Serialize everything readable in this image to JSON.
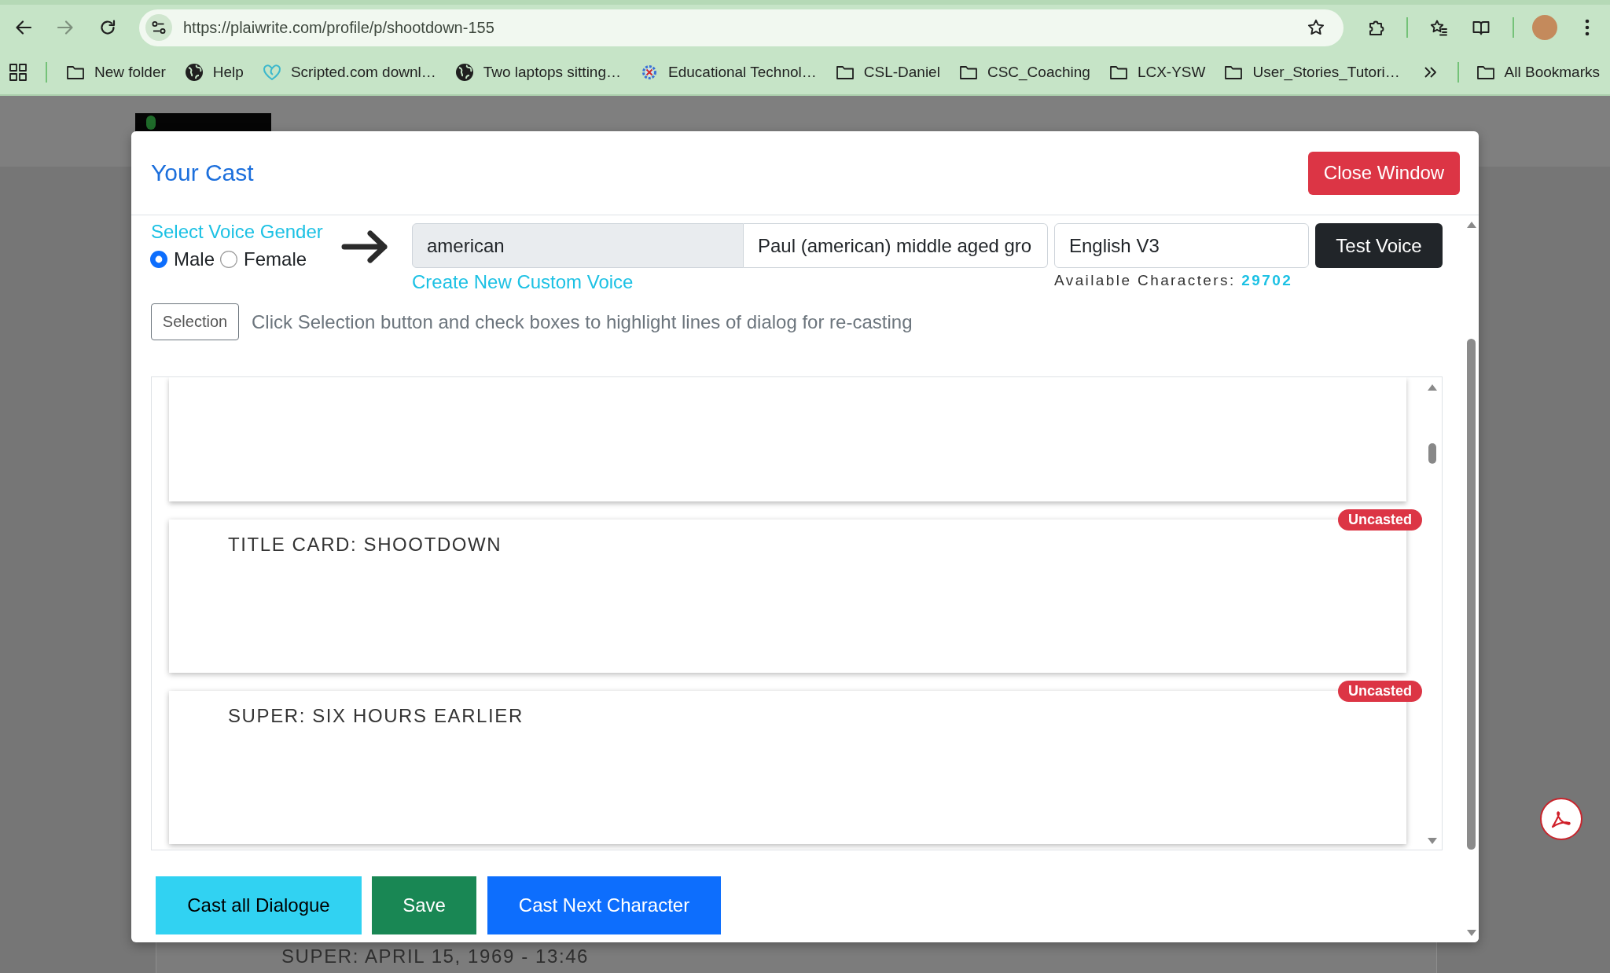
{
  "browser": {
    "forward_disabled": true,
    "url": "https://plaiwrite.com/profile/p/shootdown-155",
    "bookmarks": [
      {
        "label": "New folder",
        "kind": "folder"
      },
      {
        "label": "Help",
        "kind": "globe"
      },
      {
        "label": "Scripted.com downl…",
        "kind": "heart"
      },
      {
        "label": "Two laptops sitting…",
        "kind": "globe"
      },
      {
        "label": "Educational Technol…",
        "kind": "gear"
      },
      {
        "label": "CSL-Daniel",
        "kind": "folder"
      },
      {
        "label": "CSC_Coaching",
        "kind": "folder"
      },
      {
        "label": "LCX-YSW",
        "kind": "folder"
      },
      {
        "label": "User_Stories_Tutori…",
        "kind": "folder"
      }
    ],
    "all_bookmarks": "All Bookmarks"
  },
  "site": {
    "background_line": "SUPER: APRIL 15, 1969 - 13:46"
  },
  "modal": {
    "title": "Your Cast",
    "close_button": "Close Window",
    "gender_label": "Select Voice Gender",
    "gender_options": [
      {
        "label": "Male",
        "selected": true
      },
      {
        "label": "Female",
        "selected": false
      }
    ],
    "accent": "american",
    "voice": "Paul (american) middle aged gro",
    "model": "English V3",
    "test_button": "Test Voice",
    "custom_voice_link": "Create New Custom Voice",
    "characters": "Available Characters: **29702**",
    "selection_button": "Selection",
    "instruction": "Click Selection button and check boxes to highlight lines of dialog for re-casting",
    "cut_off_card": true,
    "lines": [
      {
        "text": "TITLE CARD: SHOOTDOWN",
        "badge": "Uncasted"
      },
      {
        "text": "SUPER: SIX HOURS EARLIER",
        "badge": "Uncasted"
      }
    ],
    "footer_buttons": [
      {
        "label": "Cast all Dialogue",
        "kind": "info"
      },
      {
        "label": "Save",
        "kind": "success"
      },
      {
        "label": "Cast Next Character",
        "kind": "primary"
      }
    ]
  }
}
